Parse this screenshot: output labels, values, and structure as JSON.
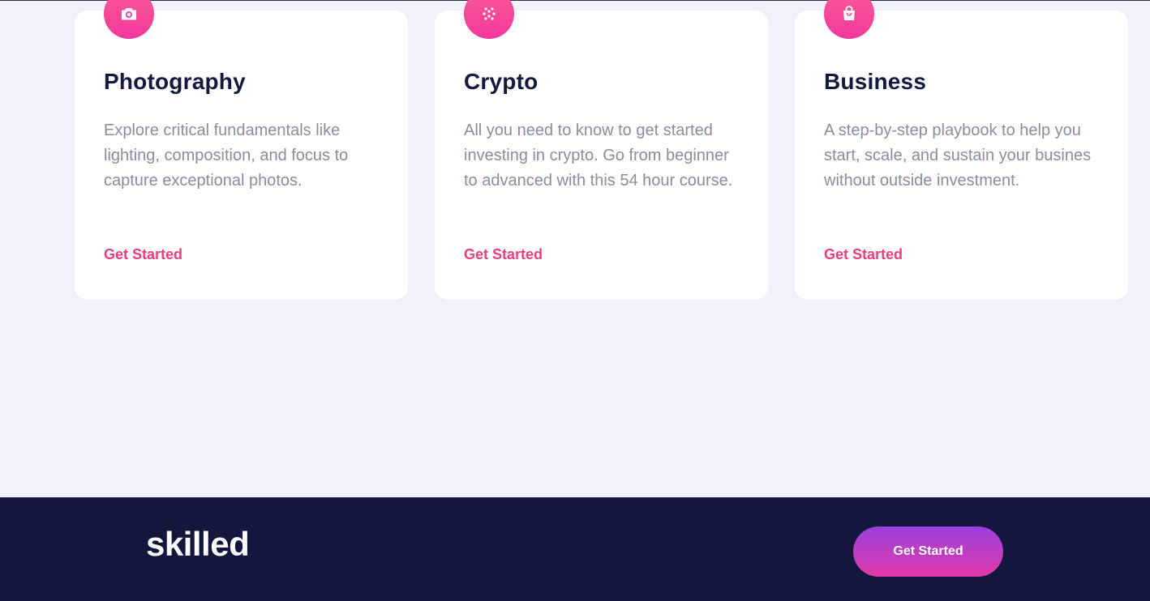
{
  "colors": {
    "page_background": "#f0f1fc",
    "card_background": "#ffffff",
    "title": "#141a3d",
    "description": "#8a8ea3",
    "link": "#ef3f78",
    "icon_gradient": [
      "#fb5a93",
      "#f2379e"
    ],
    "footer_background": "#13173e",
    "button_gradient": [
      "#9a3fe0",
      "#e23aa6"
    ]
  },
  "cards": [
    {
      "icon": "camera-icon",
      "title": "Photography",
      "description": "Explore critical fundamentals like lighting, composition, and focus to capture exceptional photos.",
      "link": "Get Started"
    },
    {
      "icon": "crypto-dots-icon",
      "title": "Crypto",
      "description": "All you need to know to get started investing in crypto. Go from beginner to advanced with this 54 hour course.",
      "link": "Get Started"
    },
    {
      "icon": "shopping-bag-icon",
      "title": "Business",
      "description": "A step-by-step playbook to help you start, scale, and sustain your busines without outside investment.",
      "link": "Get Started"
    }
  ],
  "footer": {
    "logo": "skilled",
    "button_label": "Get Started"
  }
}
